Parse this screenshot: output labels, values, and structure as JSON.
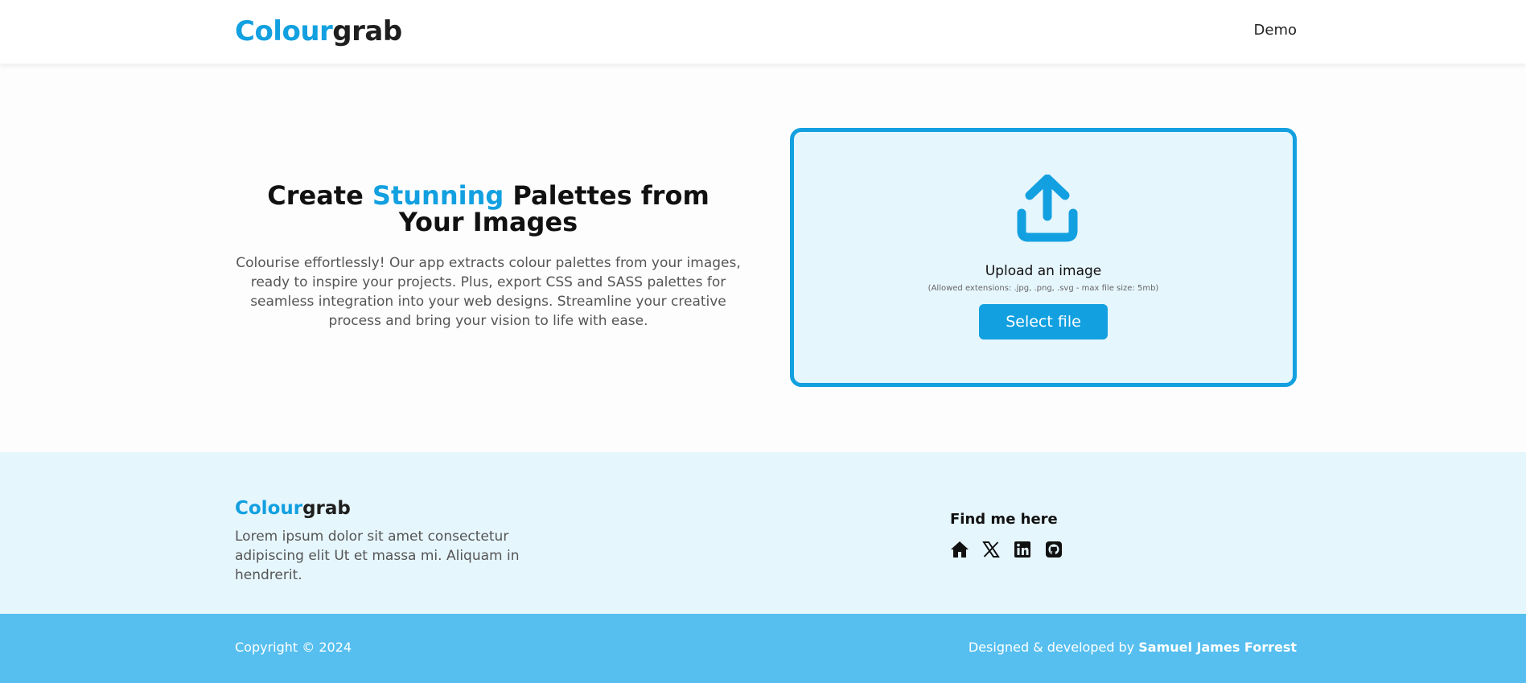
{
  "header": {
    "logo_part1": "Colour",
    "logo_part2": "grab",
    "nav_demo": "Demo"
  },
  "hero": {
    "title_pre": "Create ",
    "title_highlight": "Stunning",
    "title_post": " Palettes from Your Images",
    "description": "Colourise effortlessly! Our app extracts colour palettes from your images, ready to inspire your projects. Plus, export CSS and SASS palettes for seamless integration into your web designs. Streamline your creative process and bring your vision to life with ease."
  },
  "upload": {
    "icon": "upload-icon",
    "title": "Upload an image",
    "hint": "(Allowed extensions: .jpg, .png, .svg - max file size: 5mb)",
    "button_label": "Select file"
  },
  "footer": {
    "logo_part1": "Colour",
    "logo_part2": "grab",
    "description": "Lorem ipsum dolor sit amet consectetur adipiscing elit Ut et massa mi. Aliquam in hendrerit.",
    "find_title": "Find me here",
    "social_icons": [
      "home-icon",
      "x-icon",
      "linkedin-icon",
      "github-icon"
    ],
    "copyright": "Copyright © 2024",
    "credit_prefix": "Designed & developed by ",
    "credit_name": "Samuel James Forrest"
  },
  "colors": {
    "accent": "#12a0e0",
    "panel_bg": "#e6f6fd",
    "footer_bar": "#56bfef"
  }
}
